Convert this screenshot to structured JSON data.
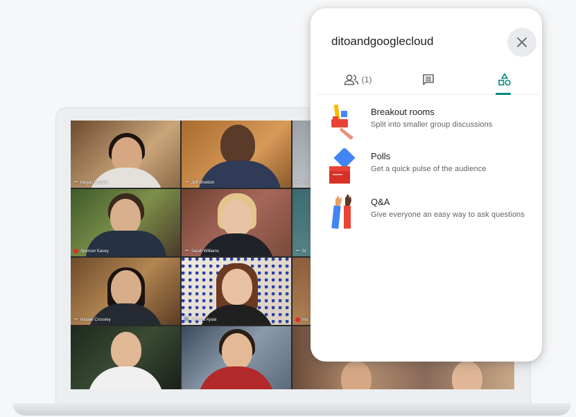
{
  "panel": {
    "meeting_title": "ditoandgooglecloud",
    "close_icon": "close-icon",
    "tabs": [
      {
        "name": "people",
        "icon": "people-icon",
        "label": "(1)"
      },
      {
        "name": "chat",
        "icon": "chat-icon",
        "label": ""
      },
      {
        "name": "activities",
        "icon": "activities-icon",
        "label": ""
      }
    ],
    "activities": [
      {
        "title": "Breakout rooms",
        "description": "Split into smaller group discussions",
        "icon": "breakout-rooms-illustration"
      },
      {
        "title": "Polls",
        "description": "Get a quick pulse of the audience",
        "icon": "polls-illustration"
      },
      {
        "title": "Q&A",
        "description": "Give everyone an easy way to ask questions",
        "icon": "qa-illustration"
      }
    ],
    "accent_color": "#00897b"
  },
  "participants": [
    {
      "name": "Megan Lozano",
      "indicator": "more"
    },
    {
      "name": "Jeff Sheldon",
      "indicator": "more"
    },
    {
      "name": "To",
      "indicator": "more"
    },
    {
      "name": "Spencer Kacey",
      "indicator": "muted"
    },
    {
      "name": "Sarah Williams",
      "indicator": "more"
    },
    {
      "name": "Br",
      "indicator": "more"
    },
    {
      "name": "Natalie Crossley",
      "indicator": "more"
    },
    {
      "name": "Jessica Ayala",
      "indicator": "talking"
    },
    {
      "name": "Ma",
      "indicator": "muted"
    }
  ]
}
